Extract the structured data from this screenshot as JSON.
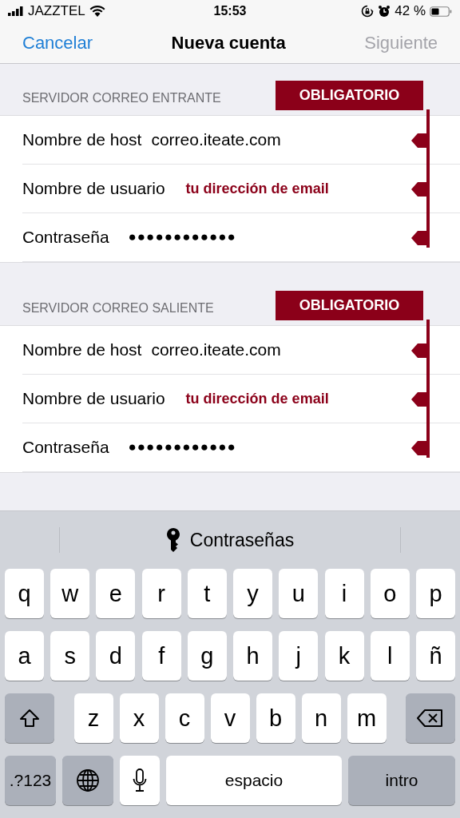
{
  "status_bar": {
    "carrier": "JAZZTEL",
    "time": "15:53",
    "battery": "42 %"
  },
  "nav": {
    "cancel": "Cancelar",
    "title": "Nueva cuenta",
    "next": {
      "label": "Siguiente",
      "disabled": true
    }
  },
  "sections": [
    {
      "header": "SERVIDOR CORREO ENTRANTE",
      "annotation": "OBLIGATORIO",
      "rows": [
        {
          "label": "Nombre de host",
          "value": "correo.iteate.com",
          "kind": "text"
        },
        {
          "label": "Nombre de usuario",
          "value": "tu dirección de email",
          "kind": "note"
        },
        {
          "label": "Contraseña",
          "value": "●●●●●●●●●●●●",
          "kind": "secret"
        }
      ]
    },
    {
      "header": "SERVIDOR CORREO SALIENTE",
      "annotation": "OBLIGATORIO",
      "rows": [
        {
          "label": "Nombre de host",
          "value": "correo.iteate.com",
          "kind": "text"
        },
        {
          "label": "Nombre de usuario",
          "value": "tu dirección de email",
          "kind": "note"
        },
        {
          "label": "Contraseña",
          "value": "●●●●●●●●●●●●",
          "kind": "secret"
        }
      ]
    }
  ],
  "keyboard": {
    "suggestion": "Contraseñas",
    "rows": [
      {
        "keys": [
          {
            "label": "q",
            "kind": "letter"
          },
          {
            "label": "w",
            "kind": "letter"
          },
          {
            "label": "e",
            "kind": "letter"
          },
          {
            "label": "r",
            "kind": "letter"
          },
          {
            "label": "t",
            "kind": "letter"
          },
          {
            "label": "y",
            "kind": "letter"
          },
          {
            "label": "u",
            "kind": "letter"
          },
          {
            "label": "i",
            "kind": "letter"
          },
          {
            "label": "o",
            "kind": "letter"
          },
          {
            "label": "p",
            "kind": "letter"
          }
        ]
      },
      {
        "keys": [
          {
            "label": "a",
            "kind": "letter"
          },
          {
            "label": "s",
            "kind": "letter"
          },
          {
            "label": "d",
            "kind": "letter"
          },
          {
            "label": "f",
            "kind": "letter"
          },
          {
            "label": "g",
            "kind": "letter"
          },
          {
            "label": "h",
            "kind": "letter"
          },
          {
            "label": "j",
            "kind": "letter"
          },
          {
            "label": "k",
            "kind": "letter"
          },
          {
            "label": "l",
            "kind": "letter"
          },
          {
            "label": "ñ",
            "kind": "letter"
          }
        ]
      },
      {
        "keys": [
          {
            "kind": "shift"
          },
          {
            "label": "z",
            "kind": "letter"
          },
          {
            "label": "x",
            "kind": "letter"
          },
          {
            "label": "c",
            "kind": "letter"
          },
          {
            "label": "v",
            "kind": "letter"
          },
          {
            "label": "b",
            "kind": "letter"
          },
          {
            "label": "n",
            "kind": "letter"
          },
          {
            "label": "m",
            "kind": "letter"
          },
          {
            "kind": "delete"
          }
        ]
      },
      {
        "keys": [
          {
            "label": ".?123",
            "kind": "numbers"
          },
          {
            "kind": "globe"
          },
          {
            "kind": "mic"
          },
          {
            "label": "espacio",
            "kind": "space"
          },
          {
            "label": "intro",
            "kind": "return"
          }
        ]
      }
    ]
  }
}
